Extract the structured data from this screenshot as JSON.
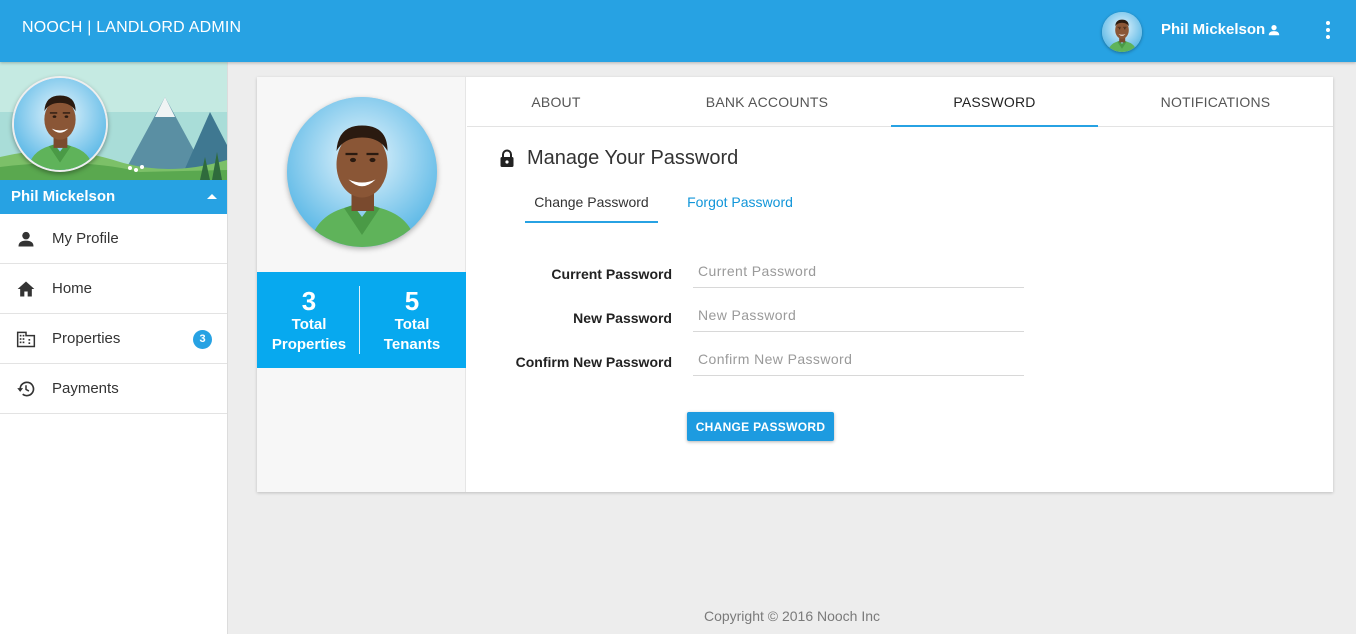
{
  "header": {
    "brand": "NOOCH | LANDLORD ADMIN",
    "username": "Phil Mickelson",
    "icons": {
      "user": "person-icon",
      "menu": "more-vert-icon"
    }
  },
  "sidebar": {
    "username": "Phil Mickelson",
    "items": [
      {
        "label": "My Profile",
        "icon": "person-icon"
      },
      {
        "label": "Home",
        "icon": "home-icon"
      },
      {
        "label": "Properties",
        "icon": "building-icon",
        "badge": "3"
      },
      {
        "label": "Payments",
        "icon": "history-icon"
      }
    ]
  },
  "profile": {
    "stats": [
      {
        "value": "3",
        "label": "Total Properties"
      },
      {
        "value": "5",
        "label": "Total Tenants"
      }
    ]
  },
  "tabs": [
    {
      "label": "ABOUT",
      "active": false
    },
    {
      "label": "BANK ACCOUNTS",
      "active": false
    },
    {
      "label": "PASSWORD",
      "active": true
    },
    {
      "label": "NOTIFICATIONS",
      "active": false
    }
  ],
  "password_section": {
    "title": "Manage Your Password",
    "subtabs": [
      {
        "label": "Change Password",
        "active": true
      },
      {
        "label": "Forgot Password",
        "active": false
      }
    ],
    "fields": [
      {
        "label": "Current Password",
        "placeholder": "Current Password",
        "value": ""
      },
      {
        "label": "New Password",
        "placeholder": "New Password",
        "value": ""
      },
      {
        "label": "Confirm New Password",
        "placeholder": "Confirm New Password",
        "value": ""
      }
    ],
    "submit_label": "CHANGE PASSWORD"
  },
  "footer": {
    "copyright": "Copyright © 2016 Nooch Inc"
  },
  "colors": {
    "primary": "#27a2e3",
    "stats_bg": "#07a9ef",
    "link": "#1296d9",
    "background": "#ededed"
  }
}
